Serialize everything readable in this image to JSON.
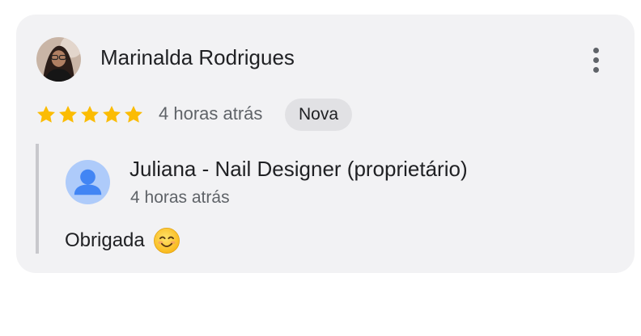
{
  "review": {
    "author_name": "Marinalda Rodrigues",
    "avatar_icon": "user-photo-avatar",
    "rating": 5,
    "rating_max": 5,
    "time": "4 horas atrás",
    "badge": "Nova",
    "menu_icon": "more-vert-icon"
  },
  "reply": {
    "owner_name": "Juliana - Nail Designer (proprietário)",
    "avatar_icon": "default-person-avatar",
    "time": "4 horas atrás",
    "text": "Obrigada",
    "emoji_icon": "smiling-face-icon"
  },
  "colors": {
    "card_bg": "#f2f2f4",
    "star": "#fbbc04",
    "badge_bg": "#e1e1e4",
    "reply_bar": "#c8c8cc",
    "avatar_blue": "#aecbfa",
    "avatar_person": "#4285f4",
    "text_primary": "#202124",
    "text_secondary": "#5f6368"
  }
}
